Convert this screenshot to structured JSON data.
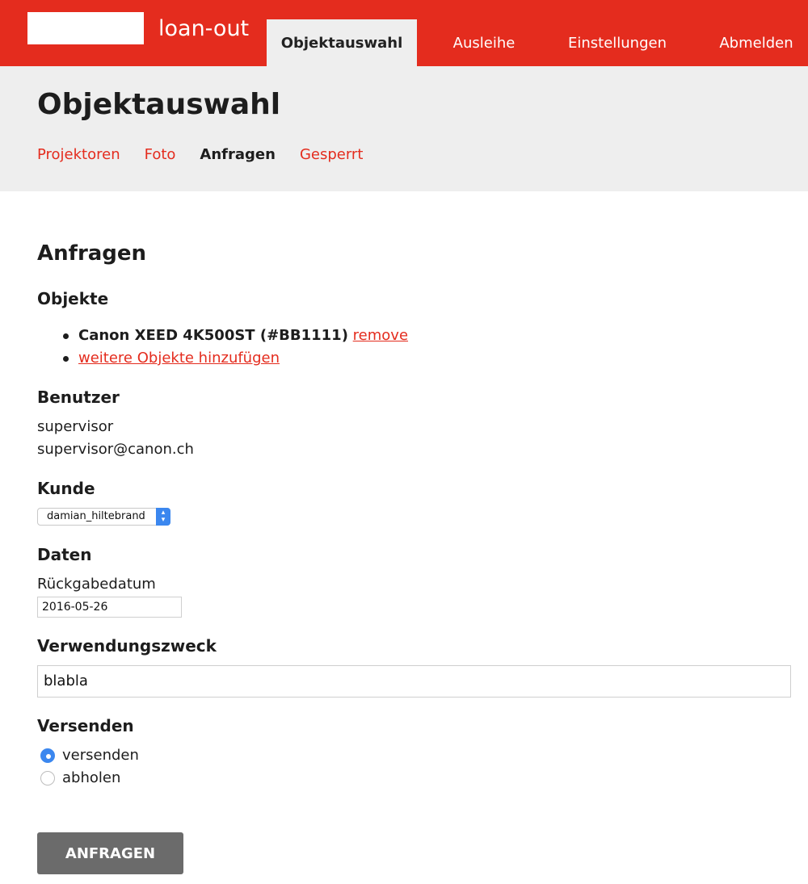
{
  "app": {
    "title": "loan-out"
  },
  "nav": {
    "tabs": [
      {
        "label": "Objektauswahl",
        "active": true
      },
      {
        "label": "Ausleihe",
        "active": false
      },
      {
        "label": "Einstellungen",
        "active": false
      },
      {
        "label": "Abmelden",
        "active": false
      }
    ]
  },
  "page": {
    "title": "Objektauswahl"
  },
  "subnav": {
    "items": [
      {
        "label": "Projektoren",
        "current": false
      },
      {
        "label": "Foto",
        "current": false
      },
      {
        "label": "Anfragen",
        "current": true
      },
      {
        "label": "Gesperrt",
        "current": false
      }
    ]
  },
  "form": {
    "title": "Anfragen",
    "objects": {
      "label": "Objekte",
      "items": [
        {
          "name": "Canon XEED 4K500ST (#BB1111)",
          "action": "remove"
        }
      ],
      "add_link": "weitere Objekte hinzufügen"
    },
    "user": {
      "label": "Benutzer",
      "name": "supervisor",
      "email": "supervisor@canon.ch"
    },
    "customer": {
      "label": "Kunde",
      "selected": "damian_hiltebrand"
    },
    "dates": {
      "label": "Daten",
      "return_label": "Rückgabedatum",
      "return_value": "2016-05-26"
    },
    "purpose": {
      "label": "Verwendungszweck",
      "value": "blabla"
    },
    "shipping": {
      "label": "Versenden",
      "options": [
        {
          "label": "versenden",
          "checked": true
        },
        {
          "label": "abholen",
          "checked": false
        }
      ]
    },
    "submit_label": "ANFRAGEN"
  },
  "colors": {
    "accent": "#e42c1e",
    "subheader_bg": "#eeeeee",
    "button_bg": "#6b6b6b",
    "radio_selected": "#3b87ef"
  }
}
